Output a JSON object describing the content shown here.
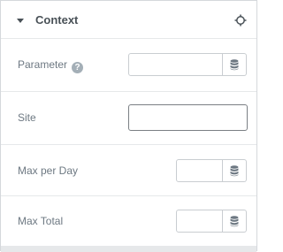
{
  "section": {
    "title": "Context"
  },
  "fields": [
    {
      "label": "Parameter",
      "has_help": true,
      "help_glyph": "?",
      "value": "",
      "dynamic_icon": "database-icon"
    },
    {
      "label": "Site",
      "value": ""
    },
    {
      "label": "Max per Day",
      "value": "",
      "dynamic_icon": "database-icon"
    },
    {
      "label": "Max Total",
      "value": "",
      "dynamic_icon": "database-icon"
    }
  ],
  "colors": {
    "label": "#6d7882",
    "title": "#495157",
    "border": "#c9cdd1",
    "divider": "#e6e8ea",
    "help_bg": "#a4afb7"
  }
}
